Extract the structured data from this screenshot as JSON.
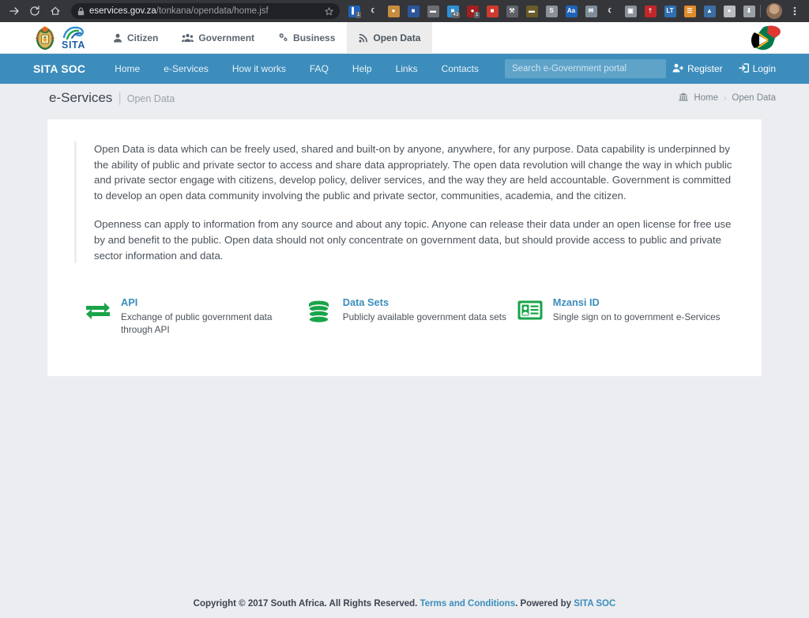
{
  "browser": {
    "back_icon": "arrow-right-icon",
    "reload_icon": "reload-icon",
    "home_icon": "home-icon",
    "lock_icon": "lock-icon",
    "url_domain": "eservices.gov.za",
    "url_path": "/tonkana/opendata/home.jsf",
    "bookmark_icon": "star-icon",
    "menu_icon": "kebab-menu-icon",
    "extensions": [
      {
        "name": "bitwarden-extension",
        "glyph": "▌",
        "color": "#1f63b8",
        "badge": "1"
      },
      {
        "name": "dark-mode-extension",
        "glyph": "☾",
        "color": "#35363a",
        "badge": ""
      },
      {
        "name": "cookie-extension",
        "glyph": "●",
        "color": "#c68c3f",
        "badge": ""
      },
      {
        "name": "office-extension",
        "glyph": "■",
        "color": "#2b579a",
        "badge": ""
      },
      {
        "name": "screen-recorder-extension",
        "glyph": "▬",
        "color": "#6b6f74",
        "badge": ""
      },
      {
        "name": "window-manager-extension",
        "glyph": "■",
        "color": "#2f8fd0",
        "badge": "43"
      },
      {
        "name": "ublock-origin-extension",
        "glyph": "●",
        "color": "#a0201e",
        "badge": "1"
      },
      {
        "name": "clipboard-extension",
        "glyph": "■",
        "color": "#cf3a2e",
        "badge": ""
      },
      {
        "name": "tools-extension",
        "glyph": "⚒",
        "color": "#5f6368",
        "badge": ""
      },
      {
        "name": "tracker-extension",
        "glyph": "▬",
        "color": "#6b5a2a",
        "badge": ""
      },
      {
        "name": "s-extension",
        "glyph": "S",
        "color": "#8a9199",
        "badge": ""
      },
      {
        "name": "font-size-extension",
        "glyph": "Aa",
        "color": "#1f63b8",
        "badge": ""
      },
      {
        "name": "mail-extension",
        "glyph": "✉",
        "color": "#7f8c9a",
        "badge": ""
      },
      {
        "name": "night-mode-extension",
        "glyph": "☾",
        "color": "#35363a",
        "badge": ""
      },
      {
        "name": "picture-in-picture-extension",
        "glyph": "▣",
        "color": "#8a9199",
        "badge": ""
      },
      {
        "name": "red-runner-extension",
        "glyph": "†",
        "color": "#c0262a",
        "badge": ""
      },
      {
        "name": "language-tool-extension",
        "glyph": "LT",
        "color": "#2f6fb0",
        "badge": ""
      },
      {
        "name": "notes-extension",
        "glyph": "☰",
        "color": "#e08b2a",
        "badge": ""
      },
      {
        "name": "privacy-badger-extension",
        "glyph": "▲",
        "color": "#3a6ea5",
        "badge": ""
      },
      {
        "name": "disc-extension",
        "glyph": "●",
        "color": "#b8bcc0",
        "badge": ""
      },
      {
        "name": "download-extension",
        "glyph": "⬇",
        "color": "#9aa0a6",
        "badge": ""
      }
    ]
  },
  "header": {
    "coat_of_arms_icon": "south-africa-coat-of-arms-icon",
    "sita_logo_icon": "sita-logo-icon",
    "sita_wordmark": "SITA",
    "flag_icon": "south-africa-flag-map-icon",
    "nav": [
      {
        "label": "Citizen",
        "icon": "user-icon",
        "active": false
      },
      {
        "label": "Government",
        "icon": "users-group-icon",
        "active": false
      },
      {
        "label": "Business",
        "icon": "gears-icon",
        "active": false
      },
      {
        "label": "Open Data",
        "icon": "rss-feed-icon",
        "active": true
      }
    ]
  },
  "navbar": {
    "brand": "SITA SOC",
    "links": [
      "Home",
      "e-Services",
      "How it works",
      "FAQ",
      "Help",
      "Links",
      "Contacts"
    ],
    "search": {
      "value": "",
      "placeholder": "Search e-Government portal",
      "icon": "search-icon"
    },
    "register": {
      "label": "Register",
      "icon": "user-plus-icon"
    },
    "login": {
      "label": "Login",
      "icon": "sign-in-icon"
    },
    "accent_color": "#3c8dbc"
  },
  "page": {
    "title": "e-Services",
    "separator": "|",
    "subtitle": "Open Data",
    "breadcrumb": {
      "home_icon": "bank-icon",
      "home_label": "Home",
      "caret": "›",
      "current": "Open Data"
    }
  },
  "content": {
    "paragraphs": [
      "Open Data is data which can be freely used, shared and built-on by anyone, anywhere, for any purpose. Data capability is underpinned by the ability of public and private sector to access and share data appropriately. The open data revolution will change the way in which public and private sector engage with citizens, develop policy, deliver services, and the way they are held accountable. Government is committed to develop an open data community involving the public and private sector, communities, academia, and the citizen.",
      "Openness can apply to information from any source and about any topic. Anyone can release their data under an open license for free use by and benefit to the public. Open data should not only concentrate on government data, but should provide access to public and private sector information and data."
    ],
    "features": [
      {
        "icon": "exchange-arrows-icon",
        "title": "API",
        "description": "Exchange of public government data through API",
        "color": "#1aa44a"
      },
      {
        "icon": "database-icon",
        "title": "Data Sets",
        "description": "Publicly available government data sets",
        "color": "#1aa44a"
      },
      {
        "icon": "id-card-icon",
        "title": "Mzansi ID",
        "description": "Single sign on to government e-Services",
        "color": "#1aa44a"
      }
    ]
  },
  "footer": {
    "copyright": "Copyright © 2017 South Africa. All Rights Reserved.",
    "terms_link": "Terms and Conditions",
    "period": ".",
    "powered_by": "Powered by",
    "powered_by_link": "SITA SOC"
  }
}
